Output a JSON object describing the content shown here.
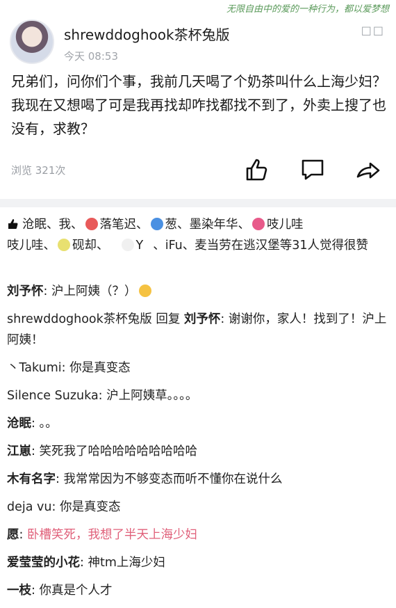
{
  "top_deco": "无限自由中的爱的一种行为，都以爱梦想",
  "post": {
    "username": "shrewddoghook茶杯兔版",
    "time": "今天 08:53",
    "body": "兄弟们，问你们个事，我前几天喝了个奶茶叫什么上海少妇？我现在又想喝了可是我再找却咋找都找不到了，外卖上搜了也没有，求教？",
    "views": "浏览 321次"
  },
  "icons": {
    "like": "thumbs-up-icon",
    "comment": "comment-icon",
    "share": "share-icon",
    "more": "more-dots-icon"
  },
  "likes": {
    "names": [
      "沧眠、",
      "我、",
      "落笔迟、",
      "葱、",
      "墨染年华、",
      "吱儿哇",
      "吱儿哇、",
      "砚却、",
      "Y",
      "、iFu、",
      "麦当劳在逃汉堡等31人觉得很赞"
    ],
    "avatar_colors": [
      "#e85a5a",
      "#4a90e2",
      "#e85a8a",
      "#e8e070",
      "#f0f0f0"
    ]
  },
  "comments": [
    {
      "name": "刘予怀",
      "text": ": 沪上阿姨（？）"
    },
    {
      "name": "shrewddoghook茶杯兔版",
      "mid": " 回复 ",
      "to": "刘予怀",
      "text": ": 谢谢你，家人！找到了！沪上阿姨！"
    },
    {
      "name": "丶Takumi",
      "text": ": 你是真变态"
    },
    {
      "name": "Silence Suzuka",
      "text": ": 沪上阿姨草。。。。"
    },
    {
      "name": "沧眠",
      "text": ": 。。"
    },
    {
      "name": "江崽",
      "text": ": 笑死我了哈哈哈哈哈哈哈哈哈"
    },
    {
      "name": "木有名字",
      "text": ": 我常常因为不够变态而听不懂你在说什么"
    },
    {
      "name": "deja vu",
      "text": ": 你是真变态"
    },
    {
      "name": "愿",
      "text": ": ",
      "pink": "卧槽笑死，我想了半天上海少妇"
    },
    {
      "name": "爱莹莹的小花",
      "text": ": 神tm上海少妇"
    },
    {
      "name": "一枝",
      "text": ": 你真是个人才"
    }
  ]
}
